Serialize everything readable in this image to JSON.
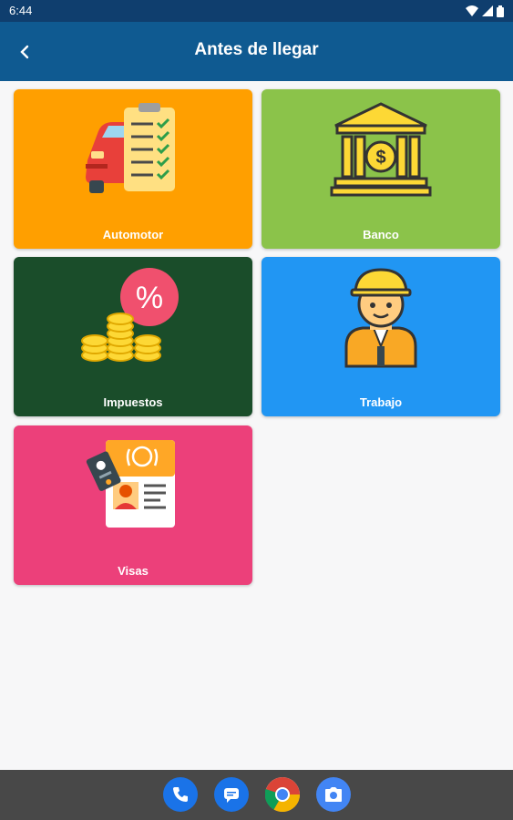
{
  "status_bar": {
    "time": "6:44"
  },
  "app_bar": {
    "title": "Antes de llegar"
  },
  "colors": {
    "status_bar": "#0f3e6e",
    "app_bar": "#0f5a91",
    "automotor": "#ff9f00",
    "banco": "#8bc34a",
    "impuestos": "#1a4d2a",
    "trabajo": "#2196f3",
    "visas": "#ec407a"
  },
  "categories": [
    {
      "label": "Automotor",
      "icon": "car-checklist-icon"
    },
    {
      "label": "Banco",
      "icon": "bank-icon"
    },
    {
      "label": "Impuestos",
      "icon": "coins-percent-icon"
    },
    {
      "label": "Trabajo",
      "icon": "worker-icon"
    },
    {
      "label": "Visas",
      "icon": "passport-id-icon"
    }
  ],
  "dock": {
    "apps": [
      "phone-icon",
      "messages-icon",
      "chrome-icon",
      "camera-icon"
    ]
  }
}
